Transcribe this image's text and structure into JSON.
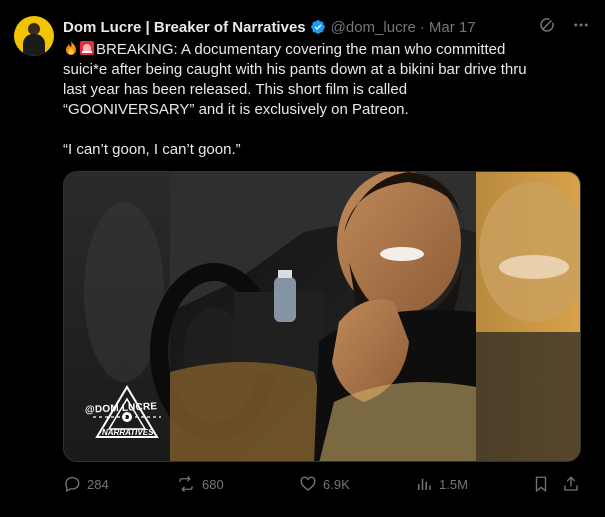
{
  "author": {
    "name": "Dom Lucre | Breaker of Narratives",
    "handle": "@dom_lucre",
    "date": "Mar 17"
  },
  "tweet": {
    "text": "BREAKING: A documentary covering the man who committed suici*e after being caught with his pants down at a bikini bar drive thru last year has been released. This short film is called “GOONIVERSARY” and it is exclusively on Patreon.",
    "quote": "“I can’t goon, I can’t goon.”"
  },
  "media": {
    "watermark": "@DOM LUCRE",
    "watermark_sub": "NARRATIVES"
  },
  "actions": {
    "replies": "284",
    "reposts": "680",
    "likes": "6.9K",
    "views": "1.5M"
  },
  "colors": {
    "background": "#000000",
    "text": "#e7e9ea",
    "secondary": "#71767b",
    "verified": "#1d9bf0"
  },
  "icons": [
    "fire-emoji",
    "siren-emoji",
    "verified-badge-icon",
    "grok-icon",
    "more-icon",
    "reply-icon",
    "repost-icon",
    "like-icon",
    "views-icon",
    "bookmark-icon",
    "share-icon"
  ]
}
